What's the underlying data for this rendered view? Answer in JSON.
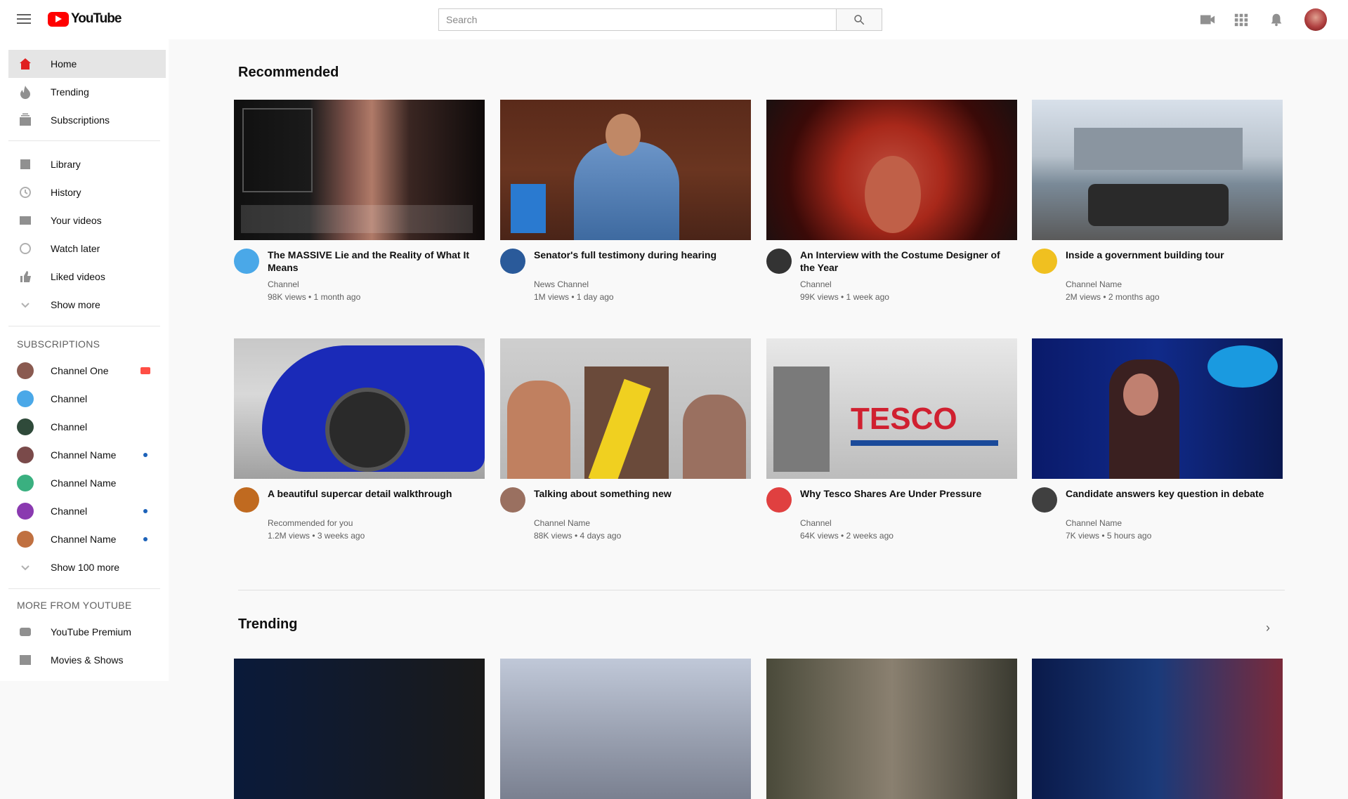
{
  "header": {
    "logo_text": "YouTube",
    "search_placeholder": "Search",
    "icons": [
      "menu-icon",
      "search-icon",
      "create-video-icon",
      "apps-icon",
      "notifications-icon",
      "account-avatar"
    ]
  },
  "sidebar": {
    "primary": [
      {
        "label": "Home",
        "icon": "home-icon",
        "active": true
      },
      {
        "label": "Trending",
        "icon": "trending-icon"
      },
      {
        "label": "Subscriptions",
        "icon": "subscriptions-icon"
      }
    ],
    "library": [
      {
        "label": "Library",
        "icon": "library-icon"
      },
      {
        "label": "History",
        "icon": "history-icon"
      },
      {
        "label": "Your videos",
        "icon": "your-videos-icon"
      },
      {
        "label": "Watch later",
        "icon": "watch-later-icon"
      },
      {
        "label": "Liked videos",
        "icon": "liked-videos-icon"
      },
      {
        "label": "Show more",
        "icon": "chevron-down-icon"
      }
    ],
    "subscriptions_heading": "SUBSCRIPTIONS",
    "subscriptions": [
      {
        "label": "Channel One",
        "color": "#8a5a50",
        "badge": "live"
      },
      {
        "label": "Channel",
        "color": "#4aa8e8",
        "badge": ""
      },
      {
        "label": "Channel",
        "color": "#2f4a3a",
        "badge": ""
      },
      {
        "label": "Channel Name",
        "color": "#7a4a4a",
        "badge": "new"
      },
      {
        "label": "Channel Name",
        "color": "#3ab080",
        "badge": ""
      },
      {
        "label": "Channel",
        "color": "#8a3ab0",
        "badge": "new"
      },
      {
        "label": "Channel Name",
        "color": "#c07040",
        "badge": "new"
      },
      {
        "label": "Show 100 more",
        "color": "",
        "badge": ""
      }
    ],
    "more_heading": "MORE FROM YOUTUBE",
    "more": [
      {
        "label": "YouTube Premium",
        "icon": "premium-icon"
      },
      {
        "label": "Movies & Shows",
        "icon": "movies-icon"
      }
    ]
  },
  "shelves": [
    {
      "title": "Recommended",
      "videos": [
        {
          "title": "The MASSIVE Lie and the Reality of What It Means",
          "channel": "Channel",
          "stats": "98K views • 1 month ago",
          "avatar": "#4aa8e8",
          "thumb": "dark-text"
        },
        {
          "title": "Senator's full testimony during hearing",
          "channel": "News Channel",
          "stats": "1M views • 1 day ago",
          "avatar": "#2a5a9a",
          "thumb": "courtroom"
        },
        {
          "title": "An Interview with the Costume Designer of the Year",
          "channel": "Channel",
          "stats": "99K views • 1 week ago",
          "avatar": "#333333",
          "thumb": "red-hat"
        },
        {
          "title": "Inside a government building tour",
          "channel": "Channel Name",
          "stats": "2M views • 2 months ago",
          "avatar": "#f0c020",
          "thumb": "street"
        }
      ]
    },
    {
      "title": "",
      "videos": [
        {
          "title": "A beautiful supercar detail walkthrough",
          "channel": "Recommended for you",
          "stats": "1.2M views • 3 weeks ago",
          "avatar": "#c06a20",
          "thumb": "blue-car",
          "top_label": "RECOMMENDED FOR YOU"
        },
        {
          "title": "Talking about something new",
          "channel": "Channel Name",
          "stats": "88K views • 4 days ago",
          "avatar": "#9a7060",
          "thumb": "sash"
        },
        {
          "title": "Why Tesco Shares Are Under Pressure",
          "channel": "Channel",
          "stats": "64K views • 2 weeks ago",
          "avatar": "#e04040",
          "thumb": "tesco"
        },
        {
          "title": "Candidate answers key question in debate",
          "channel": "Channel Name",
          "stats": "7K views • 5 hours ago",
          "avatar": "#404040",
          "thumb": "podium"
        }
      ]
    },
    {
      "title": "Trending",
      "videos": []
    }
  ],
  "colors": {
    "accent": "#ff0000",
    "active_nav": "#e5e5e5",
    "text_secondary": "#606060"
  }
}
